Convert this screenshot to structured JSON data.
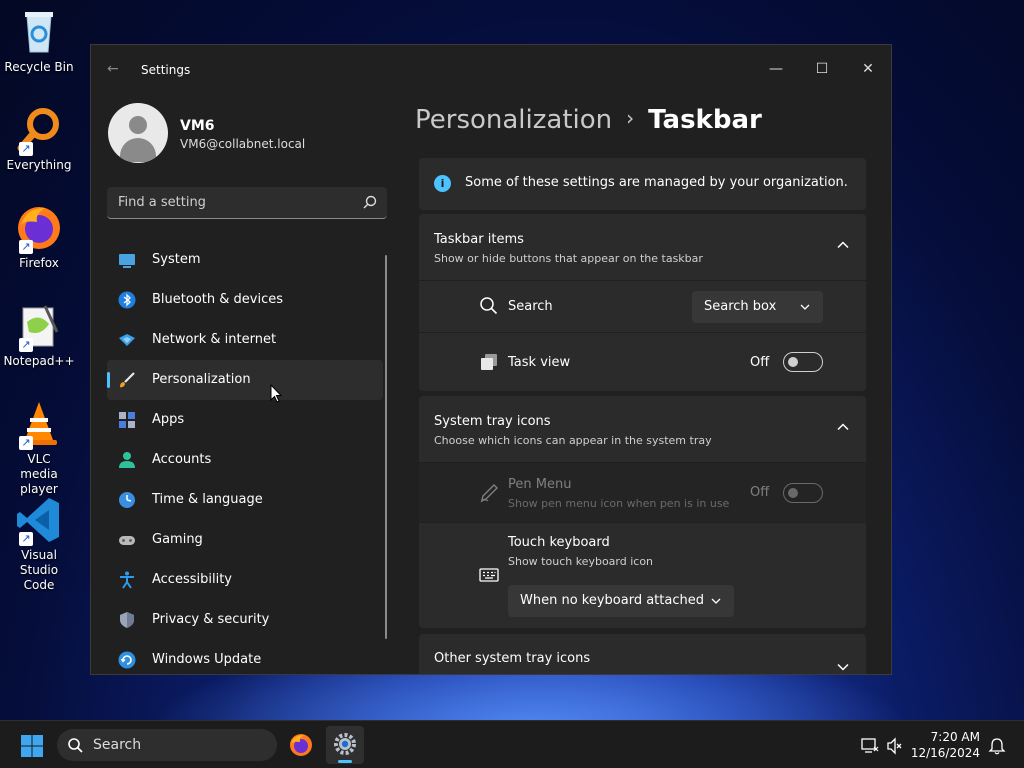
{
  "desktop": {
    "icons": [
      {
        "label": "Recycle Bin"
      },
      {
        "label": "Everything"
      },
      {
        "label": "Firefox"
      },
      {
        "label": "Notepad++"
      },
      {
        "label": "VLC media player"
      },
      {
        "label": "Visual Studio Code"
      }
    ]
  },
  "window": {
    "title": "Settings",
    "controls": {
      "minimize": "—",
      "maximize": "☐",
      "close": "✕"
    }
  },
  "user": {
    "name": "VM6",
    "email": "VM6@collabnet.local"
  },
  "search": {
    "placeholder": "Find a setting"
  },
  "nav": {
    "items": [
      {
        "label": "System",
        "icon": "system-icon"
      },
      {
        "label": "Bluetooth & devices",
        "icon": "bluetooth-icon"
      },
      {
        "label": "Network & internet",
        "icon": "network-icon"
      },
      {
        "label": "Personalization",
        "icon": "brush-icon",
        "active": true
      },
      {
        "label": "Apps",
        "icon": "apps-icon"
      },
      {
        "label": "Accounts",
        "icon": "accounts-icon"
      },
      {
        "label": "Time & language",
        "icon": "time-language-icon"
      },
      {
        "label": "Gaming",
        "icon": "gamepad-icon"
      },
      {
        "label": "Accessibility",
        "icon": "accessibility-icon"
      },
      {
        "label": "Privacy & security",
        "icon": "shield-icon"
      },
      {
        "label": "Windows Update",
        "icon": "update-icon"
      }
    ]
  },
  "breadcrumb": {
    "parent": "Personalization",
    "separator": "›",
    "current": "Taskbar"
  },
  "info": {
    "text": "Some of these settings are managed by your organization."
  },
  "taskbar_items": {
    "title": "Taskbar items",
    "subtitle": "Show or hide buttons that appear on the taskbar",
    "search": {
      "label": "Search",
      "value": "Search box"
    },
    "task_view": {
      "label": "Task view",
      "state": "Off"
    }
  },
  "system_tray": {
    "title": "System tray icons",
    "subtitle": "Choose which icons can appear in the system tray",
    "pen_menu": {
      "label": "Pen Menu",
      "subtitle": "Show pen menu icon when pen is in use",
      "state": "Off"
    },
    "touch_keyboard": {
      "label": "Touch keyboard",
      "subtitle": "Show touch keyboard icon",
      "value": "When no keyboard attached"
    }
  },
  "other_tray": {
    "title": "Other system tray icons"
  },
  "taskbar": {
    "search_label": "Search",
    "time": "7:20 AM",
    "date": "12/16/2024"
  },
  "colors": {
    "accent": "#4cc2ff",
    "window_bg": "#202020",
    "card_bg": "#2b2b2b"
  }
}
